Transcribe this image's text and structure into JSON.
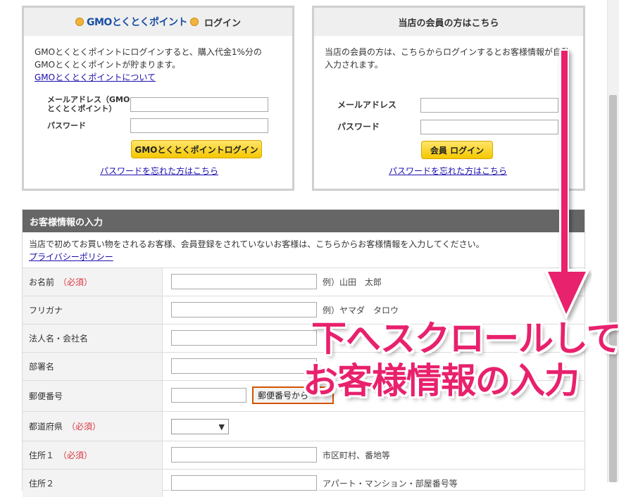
{
  "gmo_login": {
    "logo_text": "GMOとくとくポイント",
    "title": "ログイン",
    "description": "GMOとくとくポイントにログインすると、購入代金1%分のGMOとくとくポイントが貯まります。",
    "about_link": "GMOとくとくポイントについて",
    "email_label_line1": "メールアドレス（GMO",
    "email_label_line2": "とくとくポイント）",
    "password_label": "パスワード",
    "login_button": "GMOとくとくポイントログイン",
    "forgot_link": "パスワードを忘れた方はこちら"
  },
  "member_login": {
    "title": "当店の会員の方はこちら",
    "description": "当店の会員の方は、こちらからログインするとお客様情報が自動入力されます。",
    "email_label": "メールアドレス",
    "password_label": "パスワード",
    "login_button": "会員 ログイン",
    "forgot_link": "パスワードを忘れた方はこちら"
  },
  "customer_info": {
    "title": "お客様情報の入力",
    "description": "当店で初めてお買い物をされるお客様、会員登録をされていないお客様は、こちらからお客様情報を入力してください。",
    "privacy_link": "プライバシーポリシー",
    "required_mark": "（必須）",
    "rows": [
      {
        "label": "お名前",
        "required": true,
        "hint": "例）山田　太郎"
      },
      {
        "label": "フリガナ",
        "required": false,
        "hint": "例）ヤマダ　タロウ"
      },
      {
        "label": "法人名・会社名",
        "required": false,
        "hint": ""
      },
      {
        "label": "部署名",
        "required": false,
        "hint": ""
      },
      {
        "label": "郵便番号",
        "required": false,
        "hint": "",
        "button": "郵便番号から"
      },
      {
        "label": "都道府県",
        "required": true,
        "hint": "",
        "select_value": "▼"
      },
      {
        "label": "住所１",
        "required": true,
        "hint": "市区町村、番地等"
      },
      {
        "label": "住所２",
        "required": false,
        "hint": "アパート・マンション・部屋番号等"
      }
    ]
  },
  "annotation": {
    "line1": "下へスクロールして",
    "line2": "お客様情報の入力",
    "color": "#e8216d"
  }
}
